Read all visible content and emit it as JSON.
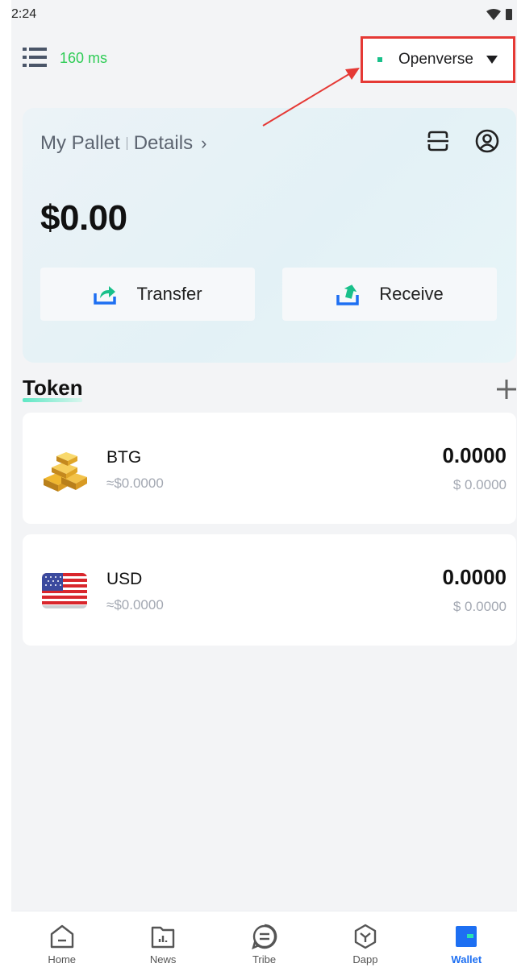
{
  "status_bar": {
    "time": "2:24"
  },
  "topbar": {
    "latency": "160 ms",
    "network": {
      "label": "Openverse"
    }
  },
  "wallet": {
    "name": "My Pallet",
    "details_label": "Details",
    "balance": "$0.00",
    "actions": [
      {
        "label": "Transfer",
        "icon": "transfer-icon"
      },
      {
        "label": "Receive",
        "icon": "receive-icon"
      }
    ]
  },
  "tokens_section": {
    "title": "Token"
  },
  "tokens": [
    {
      "symbol": "BTG",
      "fiat": "≈$0.0000",
      "amount": "0.0000",
      "usd": "$ 0.0000",
      "icon": "gold-bars-icon"
    },
    {
      "symbol": "USD",
      "fiat": "≈$0.0000",
      "amount": "0.0000",
      "usd": "$ 0.0000",
      "icon": "us-flag-icon"
    }
  ],
  "bottom_nav": {
    "items": [
      {
        "label": "Home",
        "icon": "home-icon",
        "active": false
      },
      {
        "label": "News",
        "icon": "news-icon",
        "active": false
      },
      {
        "label": "Tribe",
        "icon": "tribe-icon",
        "active": false
      },
      {
        "label": "Dapp",
        "icon": "dapp-icon",
        "active": false
      },
      {
        "label": "Wallet",
        "icon": "wallet-icon",
        "active": true
      }
    ]
  },
  "colors": {
    "accent": "#1d6ff2",
    "latency_green": "#2ecc55",
    "annotation_red": "#e53935",
    "token_accent": "#5ee7c4"
  }
}
